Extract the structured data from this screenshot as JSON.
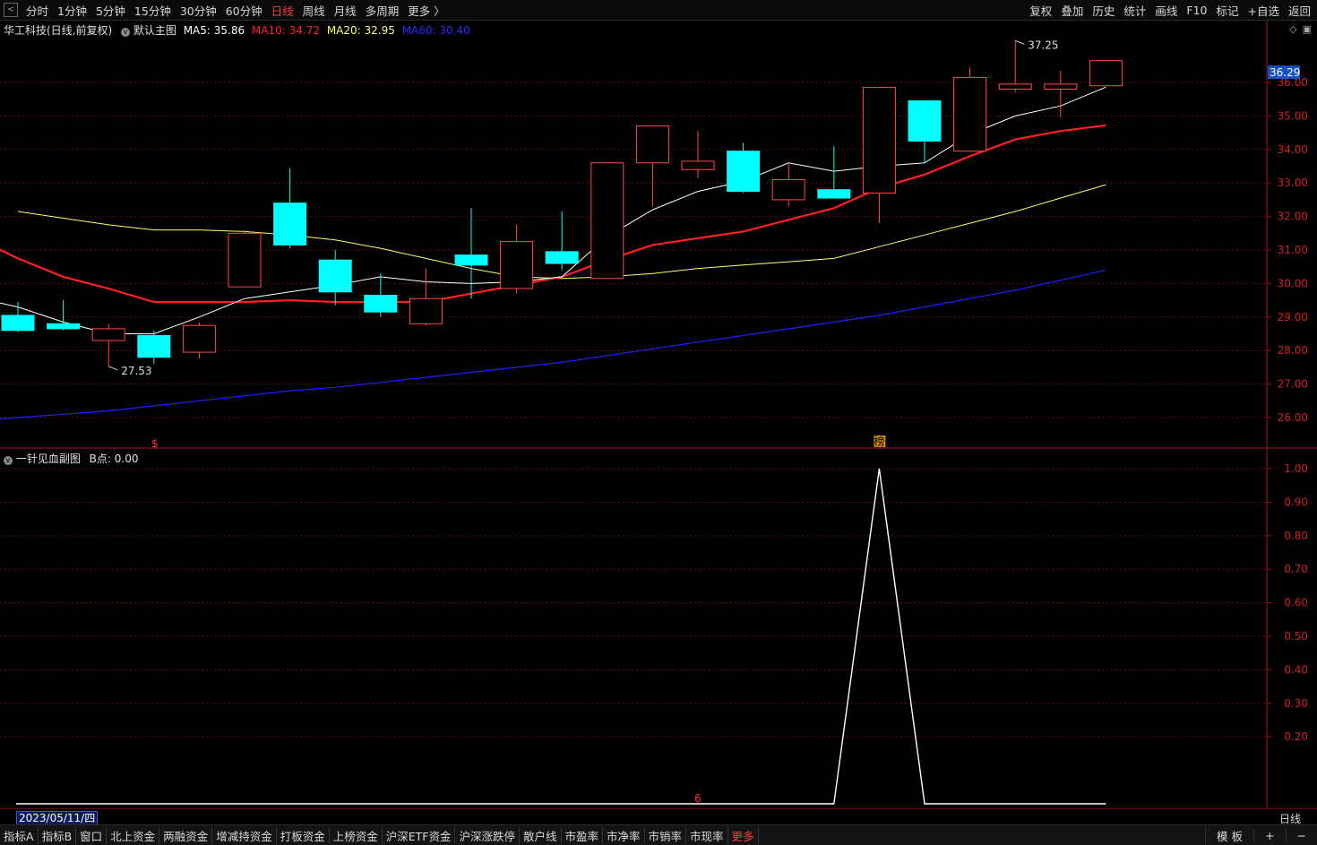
{
  "toolbar": {
    "periods": [
      "分时",
      "1分钟",
      "5分钟",
      "15分钟",
      "30分钟",
      "60分钟",
      "日线",
      "周线",
      "月线",
      "多周期",
      "更多 〉"
    ],
    "active_period": "日线",
    "right_buttons": [
      "复权",
      "叠加",
      "历史",
      "统计",
      "画线",
      "F10",
      "标记",
      "+自选",
      "返回"
    ]
  },
  "main_legend": {
    "stock": "华工科技(日线,前复权)",
    "template": "默认主图",
    "ma5_label": "MA5: 35.86",
    "ma10_label": "MA10: 34.72",
    "ma20_label": "MA20: 32.95",
    "ma60_label": "MA60: 30.40"
  },
  "colors": {
    "up": "#ff4c4c",
    "down": "#00ffff",
    "ma5": "#ffffff",
    "ma10": "#ff2020",
    "ma20": "#ffff66",
    "ma60": "#2020ff",
    "axis": "#b01010",
    "indicator": "#ffffff"
  },
  "current_price_tag": "36.29",
  "high_marker": "37.25",
  "low_marker": "27.53",
  "sub_legend": {
    "name": "一针见血副图",
    "value_label": "B点: 0.00"
  },
  "markers": {
    "s_marker": "$",
    "bang_marker": "榜",
    "six_marker": "6"
  },
  "cursor_date": "2023/05/11/四",
  "period_label": "日线",
  "bottom_tabs": [
    "指标A",
    "指标B",
    "窗口",
    "北上资金",
    "两融资金",
    "增减持资金",
    "打板资金",
    "上榜资金",
    "沪深ETF资金",
    "沪深涨跌停",
    "散户线",
    "市盈率",
    "市净率",
    "市销率",
    "市现率",
    "更多"
  ],
  "bottom_right": [
    "模 板",
    "+",
    "−"
  ],
  "chart_data": [
    {
      "type": "candlestick",
      "title": "华工科技(日线,前复权)",
      "ylim": [
        25.5,
        37.6
      ],
      "y_ticks": [
        26.0,
        27.0,
        28.0,
        29.0,
        30.0,
        31.0,
        32.0,
        33.0,
        34.0,
        35.0,
        36.0
      ],
      "candles": [
        {
          "o": 29.05,
          "h": 29.45,
          "l": 28.55,
          "c": 28.6
        },
        {
          "o": 28.8,
          "h": 29.5,
          "l": 28.6,
          "c": 28.65
        },
        {
          "o": 28.3,
          "h": 28.8,
          "l": 27.53,
          "c": 28.65
        },
        {
          "o": 28.45,
          "h": 28.6,
          "l": 27.6,
          "c": 27.8
        },
        {
          "o": 27.95,
          "h": 28.85,
          "l": 27.75,
          "c": 28.75
        },
        {
          "o": 29.9,
          "h": 31.6,
          "l": 29.9,
          "c": 31.5
        },
        {
          "o": 32.4,
          "h": 33.45,
          "l": 31.05,
          "c": 31.15
        },
        {
          "o": 30.7,
          "h": 31.0,
          "l": 29.35,
          "c": 29.75
        },
        {
          "o": 29.65,
          "h": 30.3,
          "l": 29.0,
          "c": 29.15
        },
        {
          "o": 28.8,
          "h": 30.45,
          "l": 28.75,
          "c": 29.55
        },
        {
          "o": 30.85,
          "h": 32.25,
          "l": 29.55,
          "c": 30.55
        },
        {
          "o": 29.85,
          "h": 31.75,
          "l": 29.7,
          "c": 31.25
        },
        {
          "o": 30.95,
          "h": 32.15,
          "l": 30.4,
          "c": 30.6
        },
        {
          "o": 30.15,
          "h": 33.6,
          "l": 30.15,
          "c": 33.6
        },
        {
          "o": 33.6,
          "h": 34.7,
          "l": 32.3,
          "c": 34.7
        },
        {
          "o": 33.4,
          "h": 34.55,
          "l": 33.15,
          "c": 33.65
        },
        {
          "o": 33.95,
          "h": 34.2,
          "l": 32.7,
          "c": 32.75
        },
        {
          "o": 32.5,
          "h": 33.6,
          "l": 32.3,
          "c": 33.1
        },
        {
          "o": 32.8,
          "h": 34.1,
          "l": 32.6,
          "c": 32.55
        },
        {
          "o": 32.7,
          "h": 35.85,
          "l": 31.8,
          "c": 35.85
        },
        {
          "o": 35.45,
          "h": 35.45,
          "l": 33.6,
          "c": 34.25
        },
        {
          "o": 33.95,
          "h": 36.45,
          "l": 33.95,
          "c": 36.15
        },
        {
          "o": 35.8,
          "h": 37.25,
          "l": 35.7,
          "c": 35.95
        },
        {
          "o": 35.8,
          "h": 36.35,
          "l": 34.95,
          "c": 35.95
        },
        {
          "o": 35.9,
          "h": 36.6,
          "l": 35.9,
          "c": 36.65
        }
      ],
      "ma5": [
        29.6,
        29.3,
        28.85,
        28.5,
        28.5,
        29.0,
        29.55,
        29.75,
        29.95,
        30.2,
        30.05,
        30.0,
        30.05,
        30.2,
        31.4,
        32.2,
        32.75,
        33.05,
        33.6,
        33.35,
        33.5,
        33.6,
        34.45,
        35.0,
        35.3,
        35.86
      ],
      "ma10": [
        31.4,
        30.75,
        30.2,
        29.85,
        29.45,
        29.45,
        29.45,
        29.5,
        29.45,
        29.45,
        29.45,
        29.7,
        29.95,
        30.2,
        30.7,
        31.15,
        31.35,
        31.55,
        31.9,
        32.25,
        32.85,
        33.25,
        33.8,
        34.3,
        34.55,
        34.72
      ],
      "ma20": [
        32.15,
        31.95,
        31.75,
        31.6,
        31.6,
        31.55,
        31.45,
        31.3,
        31.05,
        30.75,
        30.45,
        30.2,
        30.15,
        30.2,
        30.3,
        30.45,
        30.55,
        30.65,
        30.75,
        31.1,
        31.45,
        31.8,
        32.15,
        32.55,
        32.95
      ],
      "ma60": [
        25.9,
        26.0,
        26.1,
        26.2,
        26.35,
        26.5,
        26.65,
        26.8,
        26.9,
        27.05,
        27.2,
        27.35,
        27.5,
        27.65,
        27.85,
        28.05,
        28.25,
        28.45,
        28.65,
        28.85,
        29.05,
        29.3,
        29.55,
        29.8,
        30.1,
        30.4
      ]
    },
    {
      "type": "line",
      "title": "一针见血副图",
      "ylim": [
        0,
        1.05
      ],
      "y_ticks": [
        0.2,
        0.3,
        0.4,
        0.5,
        0.6,
        0.7,
        0.8,
        0.9,
        1.0
      ],
      "values": [
        0,
        0,
        0,
        0,
        0,
        0,
        0,
        0,
        0,
        0,
        0,
        0,
        0,
        0,
        0,
        0,
        0,
        0,
        0,
        1,
        0,
        0,
        0,
        0,
        0
      ]
    }
  ]
}
